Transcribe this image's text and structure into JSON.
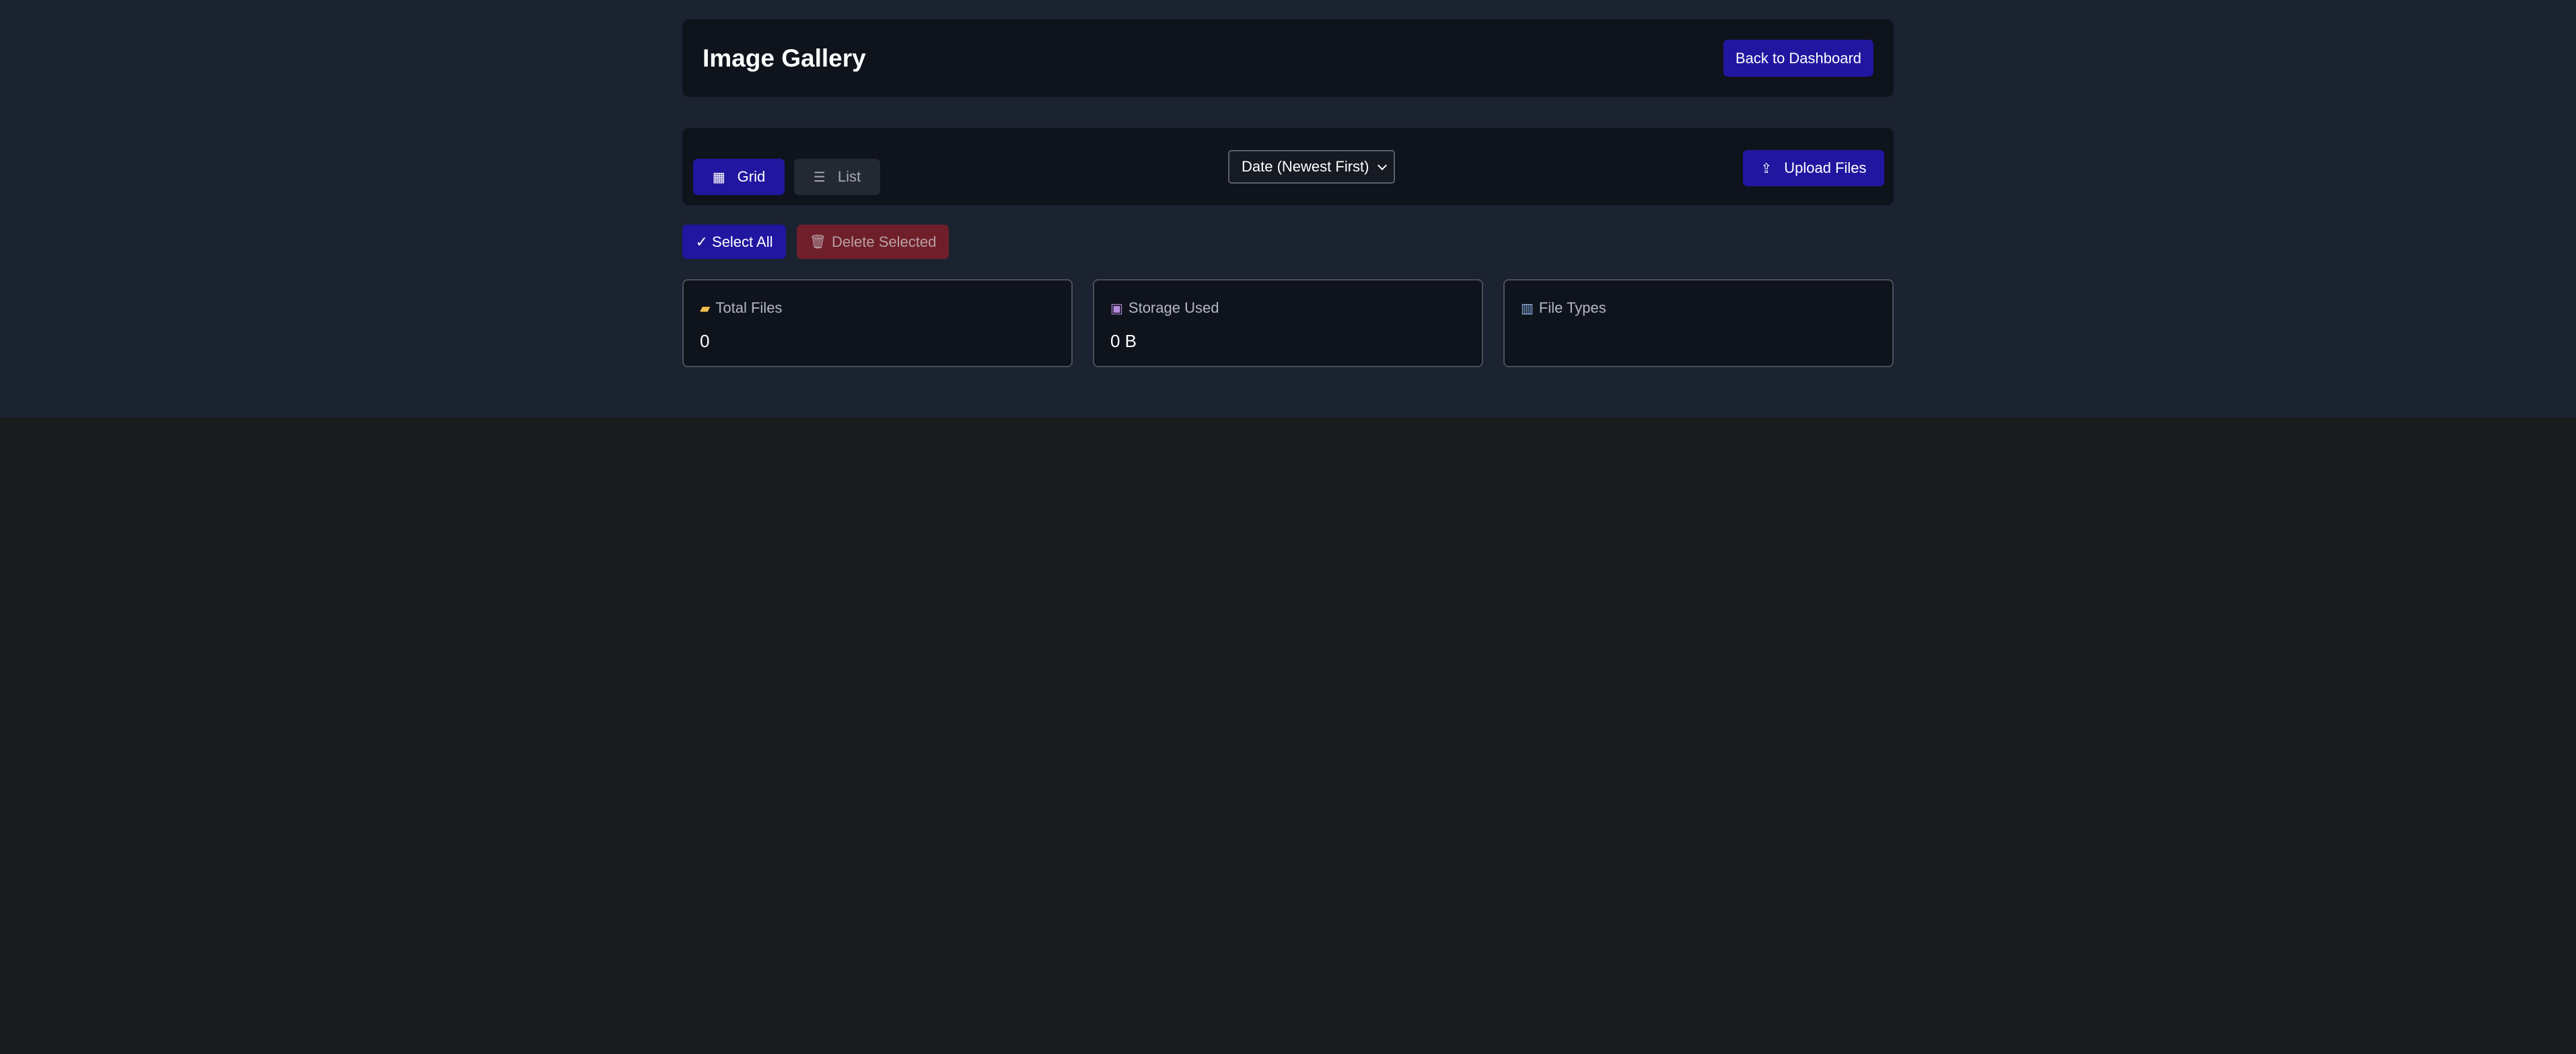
{
  "header": {
    "title": "Image Gallery",
    "back_button": "Back to Dashboard"
  },
  "toolbar": {
    "view_modes": [
      {
        "label": "Grid",
        "icon": "grid-icon",
        "active": true
      },
      {
        "label": "List",
        "icon": "list-icon",
        "active": false
      }
    ],
    "sort": {
      "selected": "Date (Newest First)"
    },
    "upload_button": "Upload Files",
    "upload_icon": "upload-icon"
  },
  "actions": {
    "select_all": "✓ Select All",
    "delete_selected": "Delete Selected",
    "delete_icon": "trash-icon"
  },
  "stats": [
    {
      "label": "Total Files",
      "icon": "folder-icon",
      "value": "0"
    },
    {
      "label": "Storage Used",
      "icon": "floppy-disk-icon",
      "value": "0 B"
    },
    {
      "label": "File Types",
      "icon": "bar-chart-icon",
      "value": ""
    }
  ],
  "colors": {
    "accent": "#21169f",
    "danger": "#6f1f2a",
    "panel": "#0f131c",
    "background": "#1b2230"
  }
}
